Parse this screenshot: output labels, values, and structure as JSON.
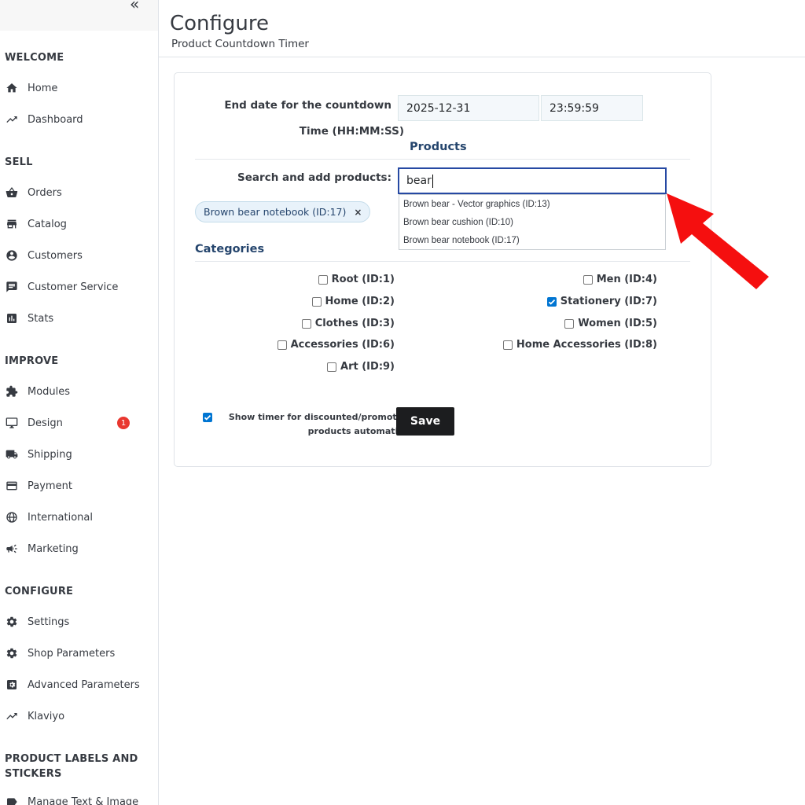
{
  "sidebar": {
    "collapse_label": "«",
    "sections": {
      "welcome": "WELCOME",
      "sell": "SELL",
      "improve": "IMPROVE",
      "configure": "CONFIGURE",
      "labels": "PRODUCT LABELS AND STICKERS"
    },
    "items": {
      "home": {
        "label": "Home",
        "icon": "home-icon"
      },
      "dashboard": {
        "label": "Dashboard",
        "icon": "trending-up-icon"
      },
      "orders": {
        "label": "Orders",
        "icon": "basket-icon"
      },
      "catalog": {
        "label": "Catalog",
        "icon": "store-icon"
      },
      "customers": {
        "label": "Customers",
        "icon": "account-circle-icon"
      },
      "customer_service": {
        "label": "Customer Service",
        "icon": "chat-icon"
      },
      "stats": {
        "label": "Stats",
        "icon": "bar-chart-icon"
      },
      "modules": {
        "label": "Modules",
        "icon": "puzzle-icon"
      },
      "design": {
        "label": "Design",
        "icon": "desktop-icon",
        "badge": "1"
      },
      "shipping": {
        "label": "Shipping",
        "icon": "truck-icon"
      },
      "payment": {
        "label": "Payment",
        "icon": "credit-card-icon"
      },
      "international": {
        "label": "International",
        "icon": "globe-icon"
      },
      "marketing": {
        "label": "Marketing",
        "icon": "megaphone-icon"
      },
      "settings": {
        "label": "Settings",
        "icon": "gear-icon"
      },
      "shop_parameters": {
        "label": "Shop Parameters",
        "icon": "gear-icon"
      },
      "advanced_parameters": {
        "label": "Advanced Parameters",
        "icon": "settings-applications-icon"
      },
      "klaviyo": {
        "label": "Klaviyo",
        "icon": "trending-up-icon"
      },
      "manage_text_image": {
        "label": "Manage Text & Image",
        "icon": "label-icon"
      }
    }
  },
  "header": {
    "title": "Configure",
    "subtitle": "Product Countdown Timer"
  },
  "form": {
    "end_date_label": "End date for the countdown",
    "end_date_value": "2025-12-31",
    "time_value": "23:59:59",
    "time_label": "Time (HH:MM:SS)",
    "products_title": "Products",
    "search_label": "Search and add products:",
    "search_value": "bear",
    "autocomplete": [
      "Brown bear - Vector graphics (ID:13)",
      "Brown bear cushion (ID:10)",
      "Brown bear notebook (ID:17)"
    ],
    "selected_chip": "Brown bear notebook (ID:17)",
    "chip_remove": "×",
    "categories_title": "Categories",
    "categories_left": [
      {
        "label": "Root (ID:1)",
        "checked": false
      },
      {
        "label": "Home (ID:2)",
        "checked": false
      },
      {
        "label": "Clothes (ID:3)",
        "checked": false
      },
      {
        "label": "Accessories (ID:6)",
        "checked": false
      },
      {
        "label": "Art (ID:9)",
        "checked": false
      }
    ],
    "categories_right": [
      {
        "label": "Men (ID:4)",
        "checked": false
      },
      {
        "label": "Stationery (ID:7)",
        "checked": true
      },
      {
        "label": "Women (ID:5)",
        "checked": false
      },
      {
        "label": "Home Accessories (ID:8)",
        "checked": false
      }
    ],
    "promo_label": "Show timer for discounted/promotional products automatically",
    "promo_checked": true,
    "save_label": "Save"
  },
  "colors": {
    "accent": "#25456d",
    "checkbox": "#0075d2",
    "badge": "#e9372f",
    "arrow": "#f50f0f",
    "save_button": "#1c1d1f"
  }
}
